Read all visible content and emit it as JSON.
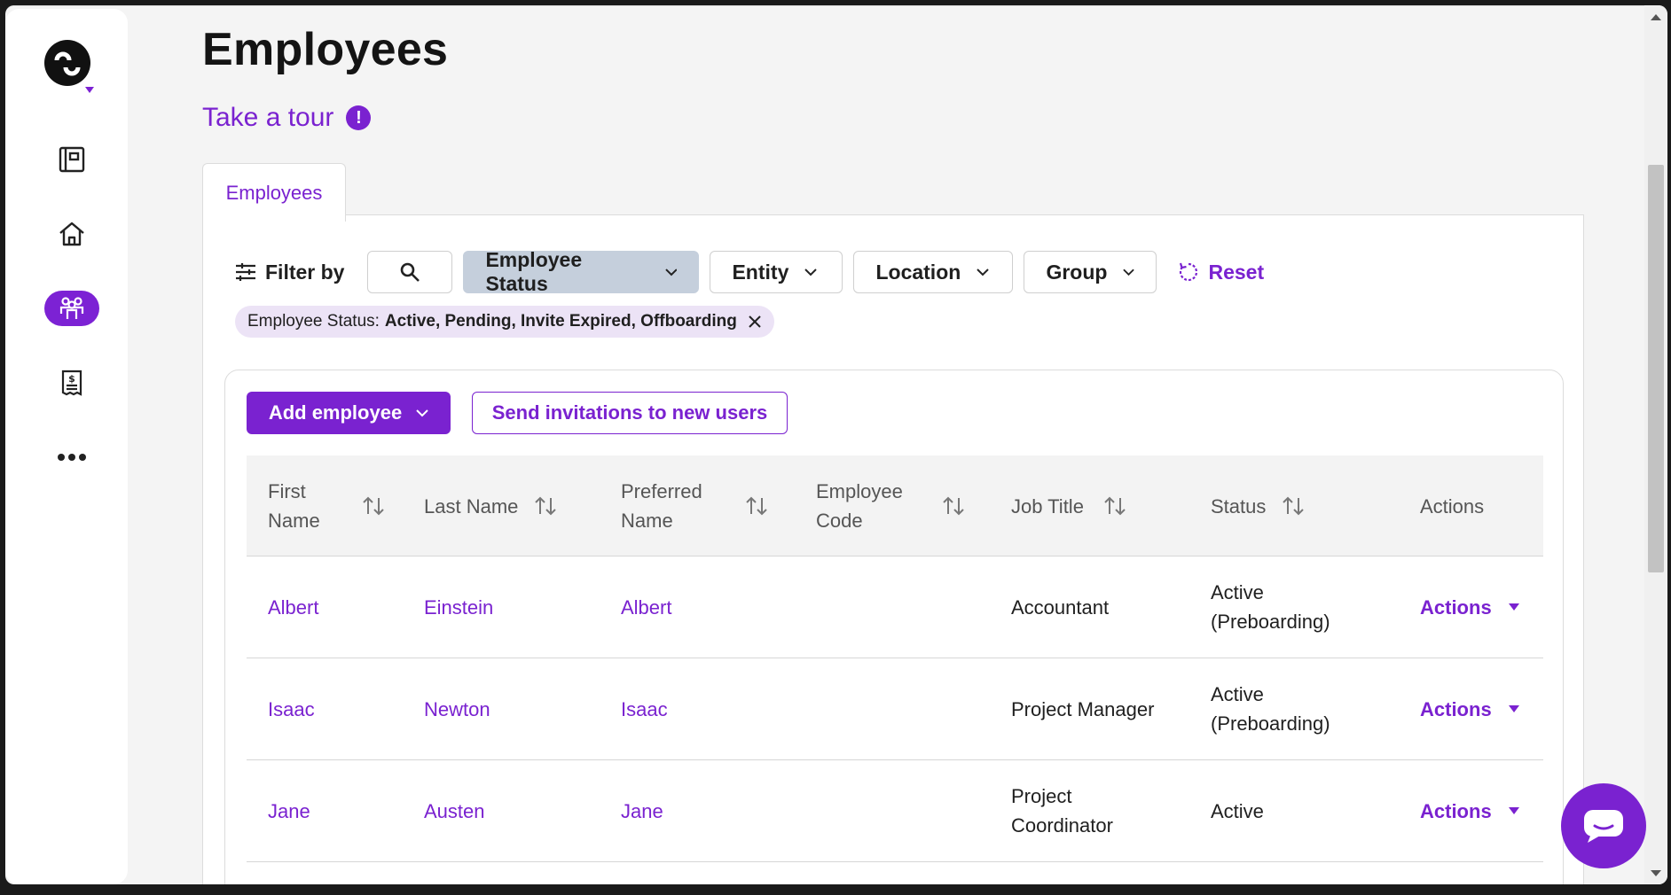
{
  "page": {
    "title": "Employees",
    "tour_label": "Take a tour",
    "tour_badge": "!"
  },
  "sidebar": {
    "items": [
      {
        "name": "handbook-icon"
      },
      {
        "name": "home-icon"
      },
      {
        "name": "people-icon",
        "active": true
      },
      {
        "name": "payroll-receipt-icon"
      },
      {
        "name": "more-icon"
      }
    ]
  },
  "tabs": [
    {
      "label": "Employees",
      "active": true
    }
  ],
  "filters": {
    "label": "Filter by",
    "buttons": [
      "Employee Status",
      "Entity",
      "Location",
      "Group"
    ],
    "reset_label": "Reset",
    "active_filter": {
      "key": "Employee Status:",
      "value": "Active, Pending, Invite Expired, Offboarding"
    }
  },
  "toolbar": {
    "add_employee": "Add employee",
    "send_invitations": "Send invitations to new users"
  },
  "table": {
    "columns": [
      {
        "line1": "First",
        "line2": "Name"
      },
      {
        "line1": "Last Name",
        "line2": ""
      },
      {
        "line1": "Preferred",
        "line2": "Name"
      },
      {
        "line1": "Employee",
        "line2": "Code"
      },
      {
        "line1": "Job Title",
        "line2": ""
      },
      {
        "line1": "Status",
        "line2": ""
      },
      {
        "line1": "Actions",
        "line2": ""
      }
    ],
    "rows": [
      {
        "first": "Albert",
        "last": "Einstein",
        "preferred": "Albert",
        "code": "",
        "job1": "Accountant",
        "job2": "",
        "status1": "Active",
        "status2": "(Preboarding)",
        "actions": "Actions"
      },
      {
        "first": "Isaac",
        "last": "Newton",
        "preferred": "Isaac",
        "code": "",
        "job1": "Project Manager",
        "job2": "",
        "status1": "Active",
        "status2": "(Preboarding)",
        "actions": "Actions"
      },
      {
        "first": "Jane",
        "last": "Austen",
        "preferred": "Jane",
        "code": "",
        "job1": "Project",
        "job2": "Coordinator",
        "status1": "Active",
        "status2": "",
        "actions": "Actions"
      }
    ]
  },
  "colors": {
    "accent": "#7a22d0",
    "active_filter_button": "#c5cfdc",
    "chip_bg": "#ece3f6"
  }
}
